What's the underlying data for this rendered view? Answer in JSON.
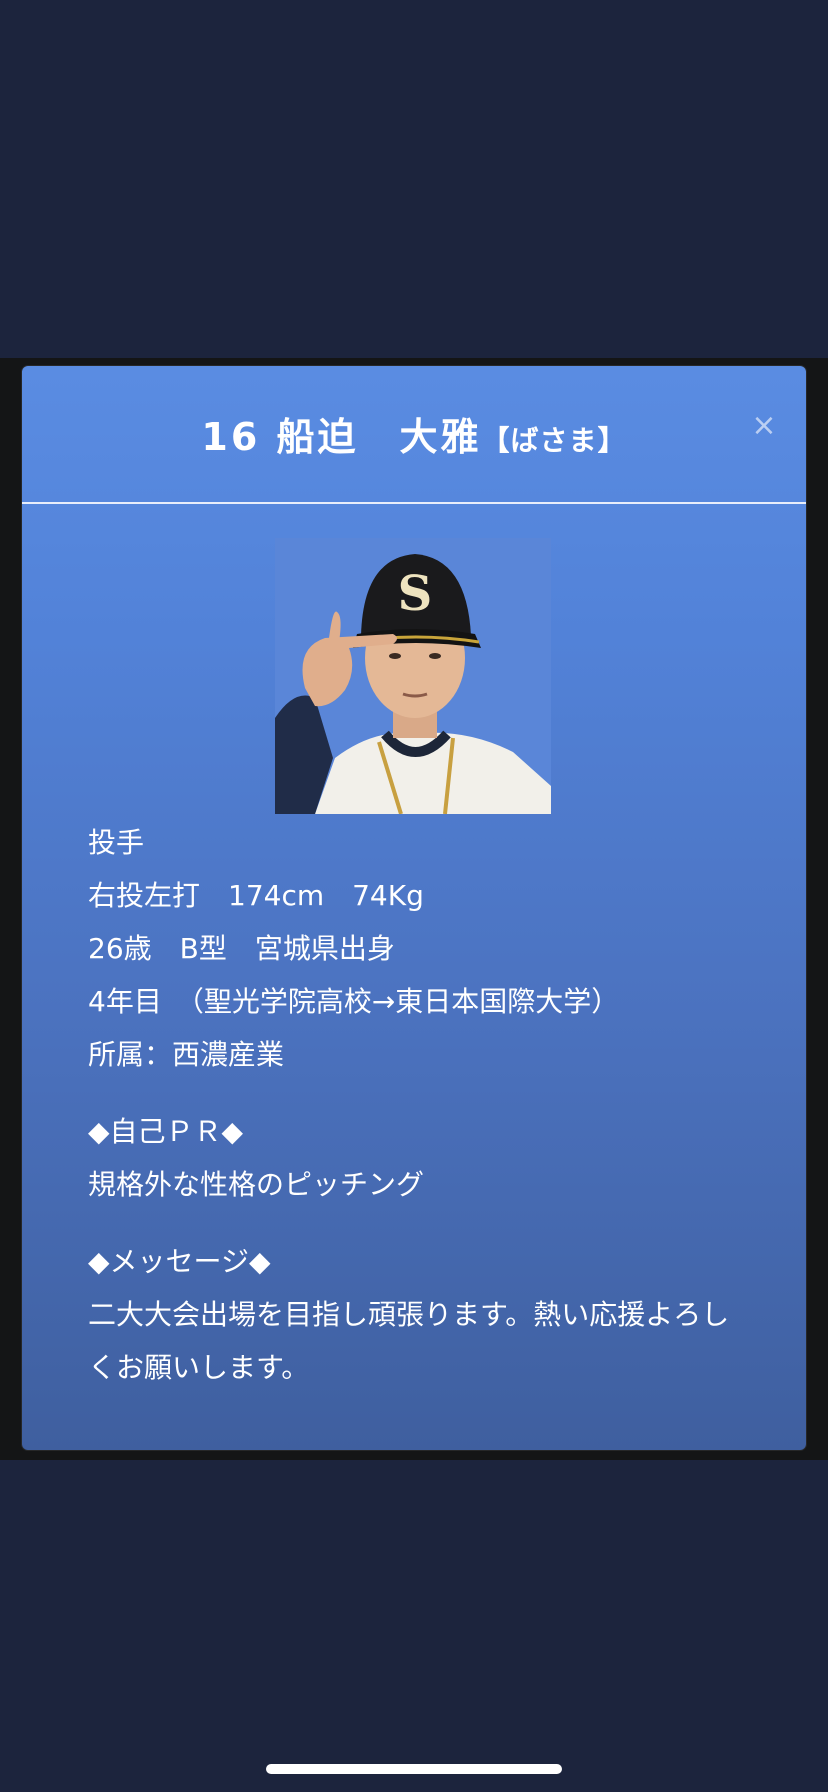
{
  "player": {
    "title_main": "16 船迫　大雅",
    "title_kana": "【ばさま】",
    "close_label": "×",
    "position": "投手",
    "physical": "右投左打　174cm　74Kg",
    "profile": "26歳　B型　宮城県出身",
    "career": "4年目　（聖光学院高校→東日本国際大学）",
    "affiliation": "所属：西濃産業",
    "pr_heading": "◆自己ＰＲ◆",
    "pr_text": "規格外な性格のピッチング",
    "message_heading": "◆メッセージ◆",
    "message_text": "二大大会出場を目指し頑張ります。熱い応援よろしくお願いします。"
  },
  "colors": {
    "page_background": "#1c243d",
    "modal_top": "#5a8ce2",
    "modal_bottom": "#3f5f9f",
    "text": "#ffffff"
  },
  "icons": {
    "close": "close-icon"
  }
}
